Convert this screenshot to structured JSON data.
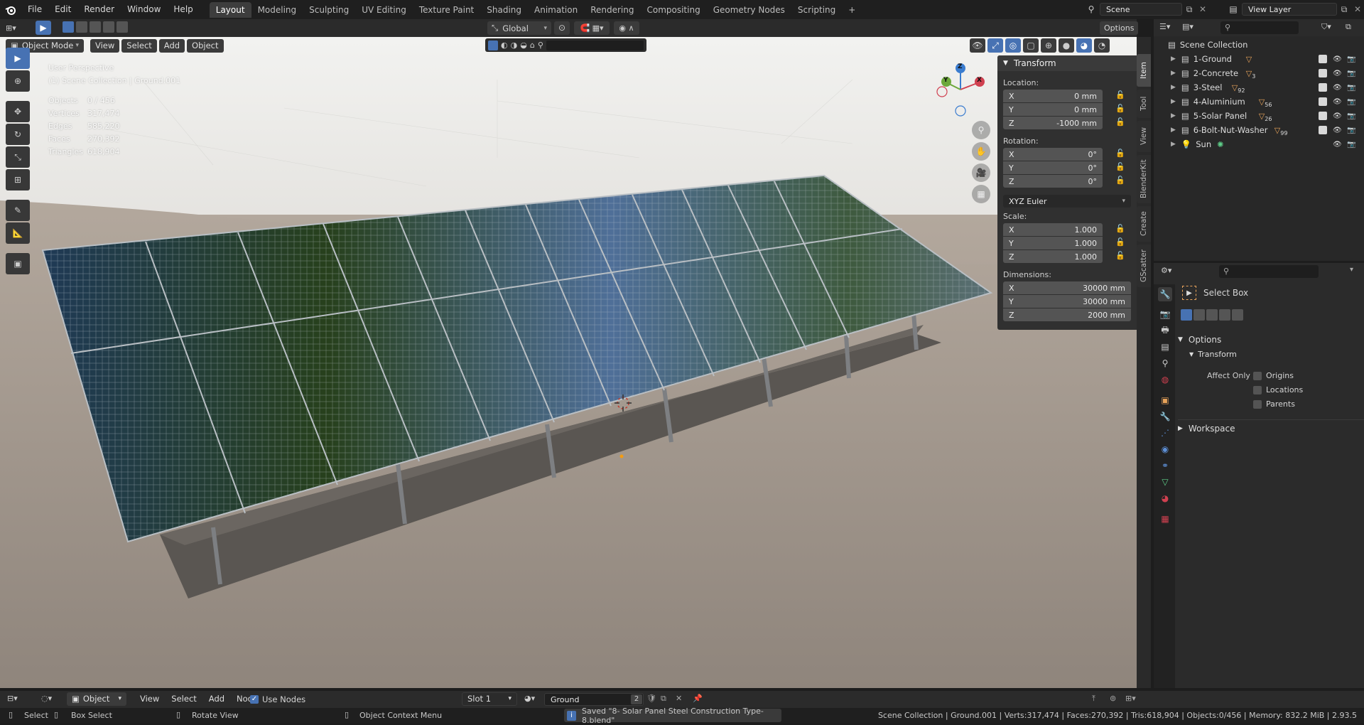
{
  "topbar": {
    "menus": [
      "File",
      "Edit",
      "Render",
      "Window",
      "Help"
    ],
    "workspaces": [
      "Layout",
      "Modeling",
      "Sculpting",
      "UV Editing",
      "Texture Paint",
      "Shading",
      "Animation",
      "Rendering",
      "Compositing",
      "Geometry Nodes",
      "Scripting"
    ],
    "active_workspace": "Layout",
    "add_tab": "+",
    "scene_label": "Scene",
    "view_layer_label": "View Layer"
  },
  "tool_header": {
    "orientation": "Global",
    "options_label": "Options"
  },
  "viewport_header": {
    "mode": "Object Mode",
    "menus": [
      "View",
      "Select",
      "Add",
      "Object"
    ]
  },
  "viewport_overlay": {
    "perspective": "User Perspective",
    "collection_path": "(1) Scene Collection | Ground.001",
    "stats": [
      {
        "label": "Objects",
        "value": "0 / 456"
      },
      {
        "label": "Vertices",
        "value": "317,474"
      },
      {
        "label": "Edges",
        "value": "585,220"
      },
      {
        "label": "Faces",
        "value": "270,392"
      },
      {
        "label": "Triangles",
        "value": "618,904"
      }
    ],
    "gizmo_axes": {
      "x": "X",
      "y": "Y",
      "z": "Z"
    }
  },
  "n_panel": {
    "title": "Transform",
    "location_label": "Location:",
    "location": [
      {
        "axis": "X",
        "value": "0 mm"
      },
      {
        "axis": "Y",
        "value": "0 mm"
      },
      {
        "axis": "Z",
        "value": "-1000 mm"
      }
    ],
    "rotation_label": "Rotation:",
    "rotation": [
      {
        "axis": "X",
        "value": "0°"
      },
      {
        "axis": "Y",
        "value": "0°"
      },
      {
        "axis": "Z",
        "value": "0°"
      }
    ],
    "rotation_mode": "XYZ Euler",
    "scale_label": "Scale:",
    "scale": [
      {
        "axis": "X",
        "value": "1.000"
      },
      {
        "axis": "Y",
        "value": "1.000"
      },
      {
        "axis": "Z",
        "value": "1.000"
      }
    ],
    "dimensions_label": "Dimensions:",
    "dimensions": [
      {
        "axis": "X",
        "value": "30000 mm"
      },
      {
        "axis": "Y",
        "value": "30000 mm"
      },
      {
        "axis": "Z",
        "value": "2000 mm"
      }
    ],
    "side_tabs": [
      "Item",
      "Tool",
      "View",
      "BlenderKit",
      "Create",
      "GScatter"
    ]
  },
  "outliner": {
    "root": "Scene Collection",
    "items": [
      {
        "name": "1-Ground",
        "badge": ""
      },
      {
        "name": "2-Concrete",
        "badge": "3"
      },
      {
        "name": "3-Steel",
        "badge": "92"
      },
      {
        "name": "4-Aluminium",
        "badge": "56"
      },
      {
        "name": "5-Solar Panel",
        "badge": "26"
      },
      {
        "name": "6-Bolt-Nut-Washer",
        "badge": "99"
      },
      {
        "name": "Sun",
        "badge": ""
      }
    ]
  },
  "properties": {
    "tool_name": "Select Box",
    "options_label": "Options",
    "transform_label": "Transform",
    "affect_only_label": "Affect Only",
    "affect_options": [
      "Origins",
      "Locations",
      "Parents"
    ],
    "workspace_label": "Workspace"
  },
  "shader_header": {
    "editor_mode": "Object",
    "menus": [
      "View",
      "Select",
      "Add",
      "Node"
    ],
    "use_nodes_label": "Use Nodes",
    "slot": "Slot 1",
    "material": "Ground",
    "users": "2"
  },
  "statusbar": {
    "select": "Select",
    "box_select": "Box Select",
    "rotate_view": "Rotate View",
    "context_menu": "Object Context Menu",
    "saved_message": "Saved \"8- Solar Panel Steel Construction Type-8.blend\"",
    "stats": "Scene Collection | Ground.001 | Verts:317,474 | Faces:270,392 | Tris:618,904 | Objects:0/456 | Memory: 832.2 MiB | 2.93.5"
  },
  "colors": {
    "accent": "#4772b3",
    "header_bg": "#2b2b2b",
    "panel_bg": "#303030",
    "collection_icon": "#e8a35a"
  }
}
